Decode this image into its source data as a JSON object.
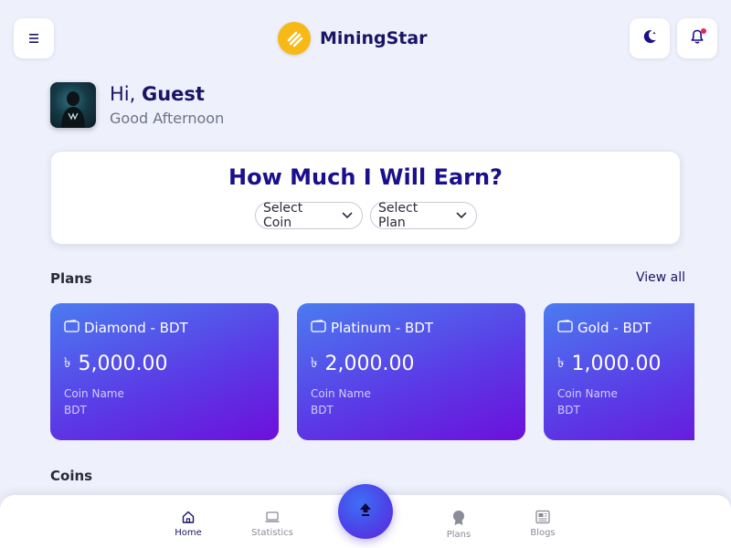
{
  "header": {
    "brand_name": "MiningStar",
    "menu_icon": "hamburger-menu-icon",
    "theme_icon": "moon-icon",
    "notification_icon": "bell-icon",
    "notification_dot_color": "#e8245b"
  },
  "greeting": {
    "hi": "Hi,",
    "name": "Guest",
    "subtitle": "Good Afternoon"
  },
  "earn": {
    "title": "How Much I Will Earn?",
    "coin_select": "Select Coin",
    "plan_select": "Select Plan"
  },
  "plans": {
    "title": "Plans",
    "view_all": "View all",
    "items": [
      {
        "name": "Diamond - BDT",
        "currency_symbol": "৳",
        "price": "5,000.00",
        "coin_label": "Coin Name",
        "coin_value": "BDT"
      },
      {
        "name": "Platinum - BDT",
        "currency_symbol": "৳",
        "price": "2,000.00",
        "coin_label": "Coin Name",
        "coin_value": "BDT"
      },
      {
        "name": "Gold - BDT",
        "currency_symbol": "৳",
        "price": "1,000.00",
        "coin_label": "Coin Name",
        "coin_value": "BDT"
      }
    ]
  },
  "coins": {
    "title": "Coins"
  },
  "nav": {
    "home": "Home",
    "statistics": "Statistics",
    "plans": "Plans",
    "blogs": "Blogs",
    "active": "Home",
    "fab_icon": "upload-arrow-icon"
  },
  "colors": {
    "primary": "#1a1464",
    "accent": "#1a0f8c",
    "card_gradient_start": "#4b7bf0",
    "card_gradient_end": "#6c10db",
    "background": "#eef0fb"
  }
}
